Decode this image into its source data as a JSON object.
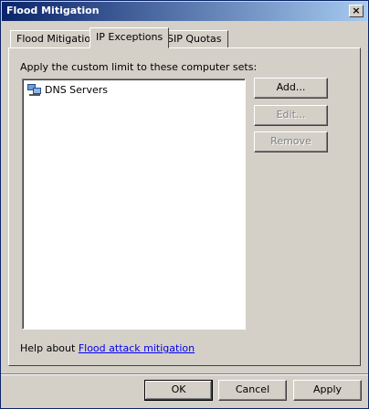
{
  "window": {
    "title": "Flood Mitigation",
    "close_glyph": "×"
  },
  "tabs": [
    {
      "label": "Flood Mitigation",
      "active": false
    },
    {
      "label": "IP Exceptions",
      "active": true
    },
    {
      "label": "SIP Quotas",
      "active": false
    }
  ],
  "panel": {
    "instruction": "Apply the custom limit to these computer sets:",
    "computer_sets": [
      {
        "name": "DNS Servers",
        "icon": "computer-set-icon"
      }
    ],
    "buttons": {
      "add": "Add...",
      "edit": "Edit...",
      "remove": "Remove"
    },
    "help_prefix": "Help about ",
    "help_link": "Flood attack mitigation"
  },
  "footer": {
    "ok": "OK",
    "cancel": "Cancel",
    "apply": "Apply"
  }
}
